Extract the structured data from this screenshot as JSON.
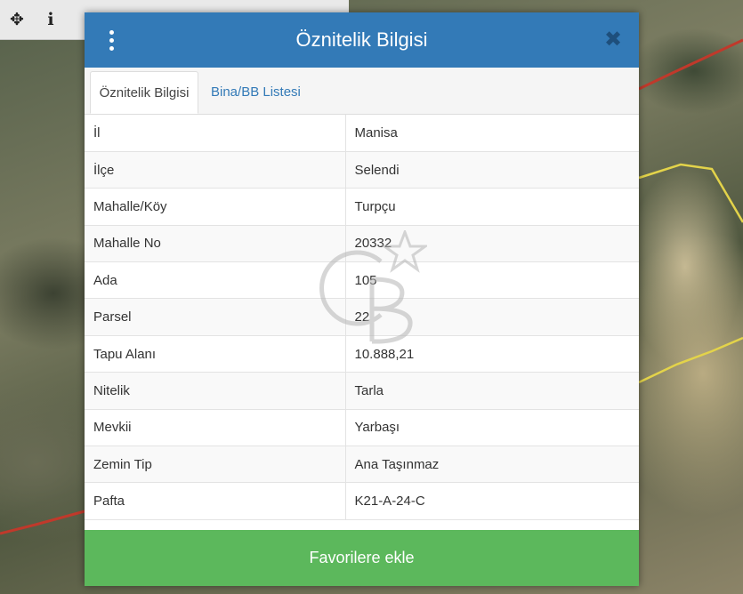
{
  "toolbar": {
    "tools": [
      {
        "icon": "move-icon",
        "glyph": "✥"
      },
      {
        "icon": "info-icon",
        "glyph": "i"
      }
    ]
  },
  "modal": {
    "title": "Öznitelik Bilgisi",
    "close_glyph": "✖",
    "tabs": [
      {
        "label": "Öznitelik Bilgisi",
        "active": true
      },
      {
        "label": "Bina/BB Listesi",
        "active": false
      }
    ],
    "rows": [
      {
        "key": "İl",
        "value": "Manisa"
      },
      {
        "key": "İlçe",
        "value": "Selendi"
      },
      {
        "key": "Mahalle/Köy",
        "value": "Turpçu"
      },
      {
        "key": "Mahalle No",
        "value": "20332"
      },
      {
        "key": "Ada",
        "value": "105"
      },
      {
        "key": "Parsel",
        "value": "22"
      },
      {
        "key": "Tapu Alanı",
        "value": "10.888,21"
      },
      {
        "key": "Nitelik",
        "value": "Tarla"
      },
      {
        "key": "Mevkii",
        "value": "Yarbaşı"
      },
      {
        "key": "Zemin Tip",
        "value": "Ana Taşınmaz"
      },
      {
        "key": "Pafta",
        "value": "K21-A-24-C"
      }
    ],
    "favorite_button": "Favorilere ekle"
  },
  "colors": {
    "header": "#337ab7",
    "tab_link": "#337ab7",
    "favorite": "#5cb85c",
    "parcel_border": "#e3d34a",
    "admin_border": "#c0392b"
  }
}
